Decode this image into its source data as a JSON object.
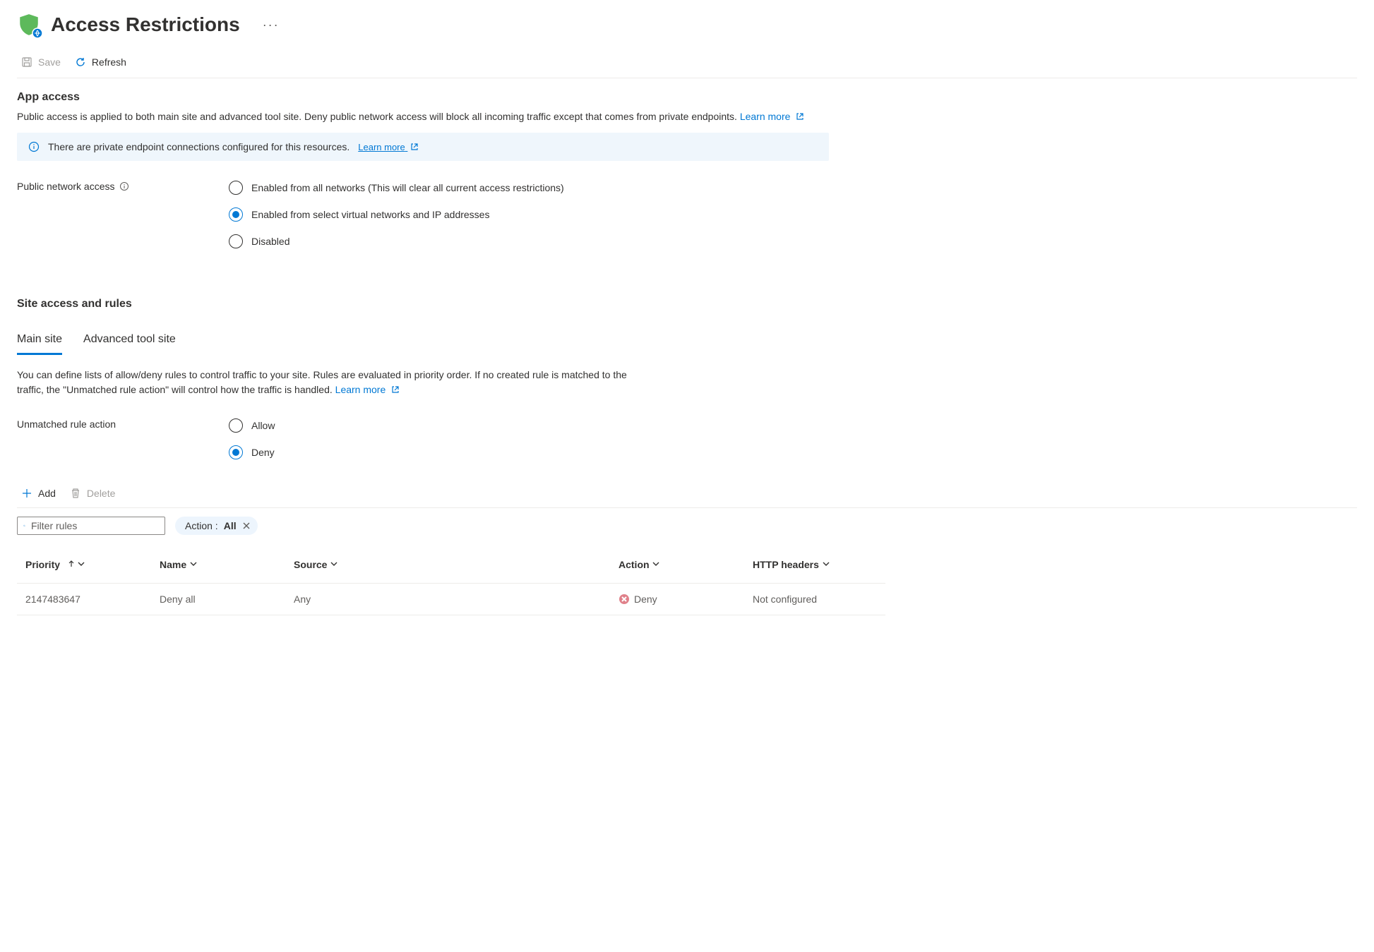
{
  "header": {
    "title": "Access Restrictions",
    "more": "···"
  },
  "toolbar": {
    "save": "Save",
    "refresh": "Refresh"
  },
  "app_access": {
    "title": "App access",
    "desc": "Public access is applied to both main site and advanced tool site. Deny public network access will block all incoming traffic except that comes from private endpoints.",
    "learn_more": "Learn more",
    "banner_text": "There are private endpoint connections configured for this resources.",
    "banner_learn_more": "Learn more",
    "label": "Public network access",
    "options": {
      "all": "Enabled from all networks (This will clear all current access restrictions)",
      "select": "Enabled from select virtual networks and IP addresses",
      "disabled": "Disabled"
    }
  },
  "site_rules": {
    "title": "Site access and rules",
    "tabs": {
      "main": "Main site",
      "advanced": "Advanced tool site"
    },
    "desc": "You can define lists of allow/deny rules to control traffic to your site. Rules are evaluated in priority order. If no created rule is matched to the traffic, the \"Unmatched rule action\" will control how the traffic is handled.",
    "learn_more": "Learn more",
    "unmatched_label": "Unmatched rule action",
    "unmatched_options": {
      "allow": "Allow",
      "deny": "Deny"
    },
    "add": "Add",
    "delete": "Delete",
    "search_placeholder": "Filter rules",
    "filter_pill_prefix": "Action : ",
    "filter_pill_value": "All",
    "columns": {
      "priority": "Priority",
      "name": "Name",
      "source": "Source",
      "action": "Action",
      "http": "HTTP headers"
    },
    "rows": [
      {
        "priority": "2147483647",
        "name": "Deny all",
        "source": "Any",
        "action": "Deny",
        "http": "Not configured"
      }
    ]
  }
}
